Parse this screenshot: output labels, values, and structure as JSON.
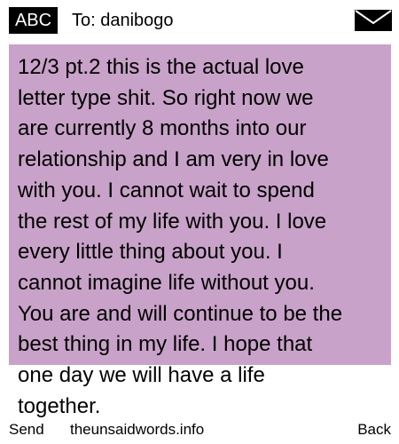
{
  "header": {
    "mode": "ABC",
    "recipient": "To: danibogo",
    "envelope_icon": "envelope-icon"
  },
  "message": {
    "text": "12/3 pt.2 this is the actual love\nletter type shit. So right now we\nare currently 8 months into our\nrelationship and I am very in love\nwith you. I cannot wait to spend\nthe rest of my life with you. I love\nevery little thing about you. I\ncannot imagine life without you.\nYou are and will continue to be the\nbest thing in my life. I hope that\none day we will have a life\ntogether."
  },
  "footer": {
    "send_label": "Send",
    "site": "theunsaidwords.info",
    "back_label": "Back"
  },
  "colors": {
    "message_background": "#c8a2c8",
    "badge_background": "#000000"
  }
}
